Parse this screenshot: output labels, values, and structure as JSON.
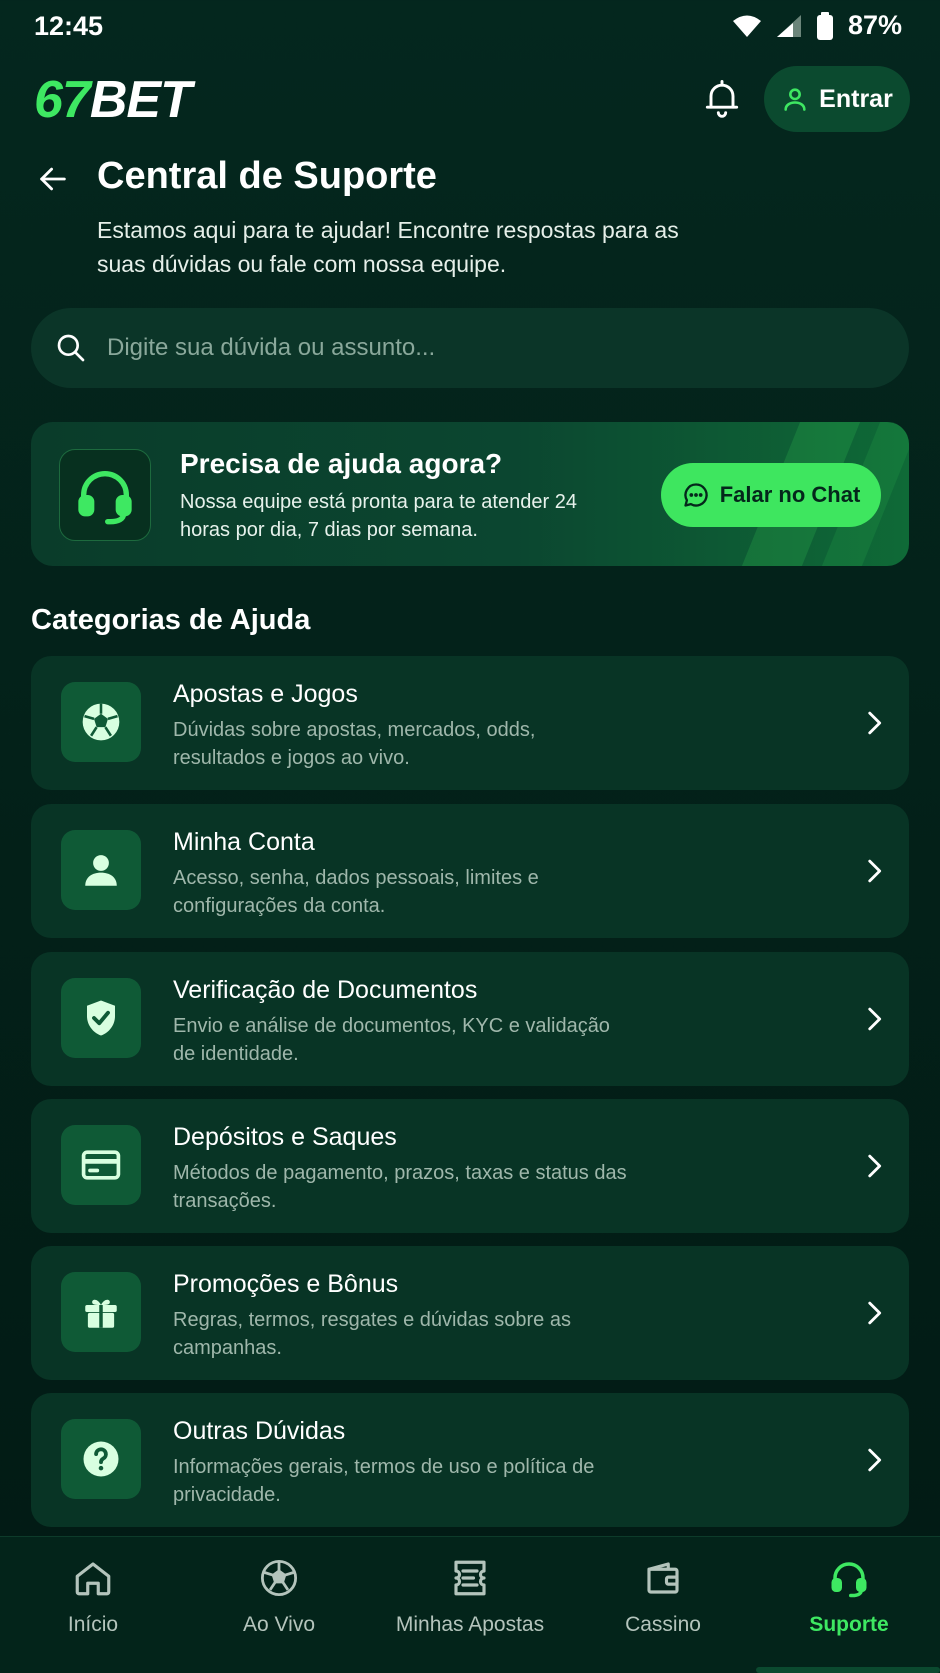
{
  "status_bar": {
    "time": "12:45",
    "battery": "87%"
  },
  "header": {
    "logo_accent": "67",
    "logo_main": "BET",
    "login_label": "Entrar"
  },
  "page": {
    "title": "Central de Suporte",
    "subtitle": "Estamos aqui para te ajudar! Encontre respostas para as suas dúvidas ou fale com nossa equipe."
  },
  "search": {
    "placeholder": "Digite sua dúvida ou assunto..."
  },
  "help_banner": {
    "title": "Precisa de ajuda agora?",
    "text": "Nossa equipe está pronta para te atender 24 horas por dia, 7 dias por semana.",
    "button_label": "Falar no Chat"
  },
  "categories": {
    "title": "Categorias de Ajuda",
    "items": [
      {
        "icon": "soccer-ball-icon",
        "title": "Apostas e Jogos",
        "description": "Dúvidas sobre apostas, mercados, odds, resultados e jogos ao vivo."
      },
      {
        "icon": "user-icon",
        "title": "Minha Conta",
        "description": "Acesso, senha, dados pessoais, limites e configurações da conta."
      },
      {
        "icon": "shield-check-icon",
        "title": "Verificação de Documentos",
        "description": "Envio e análise de documentos, KYC e validação de identidade."
      },
      {
        "icon": "credit-card-icon",
        "title": "Depósitos e Saques",
        "description": "Métodos de pagamento, prazos, taxas e status das transações."
      },
      {
        "icon": "gift-icon",
        "title": "Promoções e Bônus",
        "description": "Regras, termos, resgates e dúvidas sobre as campanhas."
      },
      {
        "icon": "question-icon",
        "title": "Outras Dúvidas",
        "description": "Informações gerais, termos de uso e política de privacidade."
      }
    ]
  },
  "bottom_nav": {
    "items": [
      {
        "label": "Início",
        "icon": "home-icon"
      },
      {
        "label": "Ao Vivo",
        "icon": "soccer-ball-icon"
      },
      {
        "label": "Minhas Apostas",
        "icon": "ticket-icon"
      },
      {
        "label": "Cassino",
        "icon": "wallet-icon"
      },
      {
        "label": "Suporte",
        "icon": "headset-icon",
        "active": true
      }
    ]
  },
  "colors": {
    "accent": "#3ee862",
    "background": "#04271e",
    "card": "#083425",
    "icon_box": "#0f5a36"
  }
}
